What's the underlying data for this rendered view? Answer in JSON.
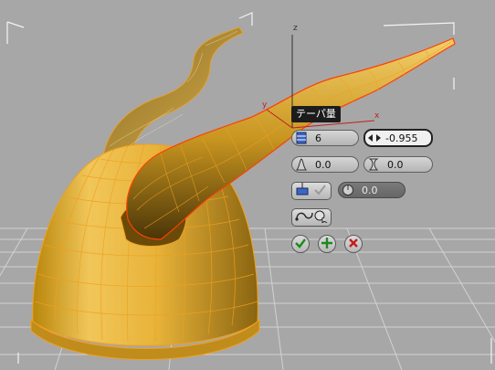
{
  "tooltip": "テーパ量",
  "caddy": {
    "segments": "6",
    "amount": "-0.955",
    "curve1": "0.0",
    "curve2": "0.0",
    "shape": "0.0"
  },
  "axes": {
    "x": "x",
    "y": "y",
    "z": "z"
  },
  "colors": {
    "background": "#a7a7a7",
    "helmet": "#e3b03a",
    "wire": "#f0a020",
    "selection": "#ff4000"
  },
  "icons": {
    "segments": "segments-icon",
    "amount": "taper-amount-icon",
    "curve1": "curve1-icon",
    "curve2": "curve2-icon",
    "local": "local-pivot-icon",
    "shape": "shape-icon",
    "loop": "loop-select-icon",
    "ok": "check-icon",
    "apply": "plus-icon",
    "cancel": "cancel-icon"
  }
}
